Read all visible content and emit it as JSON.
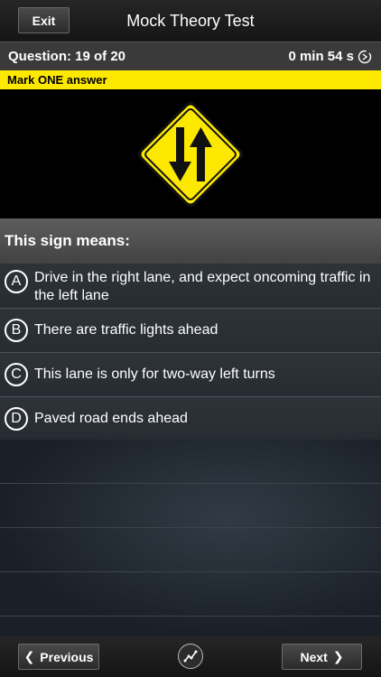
{
  "header": {
    "exit_label": "Exit",
    "title": "Mock Theory Test"
  },
  "status": {
    "question_counter": "Question: 19 of 20",
    "timer": "0 min 54 s",
    "timer_icon": "timer-icon"
  },
  "instruction": "Mark ONE answer",
  "sign": {
    "icon": "two-way-traffic-sign-icon",
    "color": "#fde800"
  },
  "question": "This sign means:",
  "answers": [
    {
      "letter": "A",
      "text": "Drive in the right lane, and expect oncoming traffic in the left lane"
    },
    {
      "letter": "B",
      "text": "There are traffic lights ahead"
    },
    {
      "letter": "C",
      "text": "This lane is only for two-way left turns"
    },
    {
      "letter": "D",
      "text": "Paved road ends ahead"
    }
  ],
  "footer": {
    "previous_label": "Previous",
    "next_label": "Next",
    "progress_icon": "progress-chart-icon"
  }
}
